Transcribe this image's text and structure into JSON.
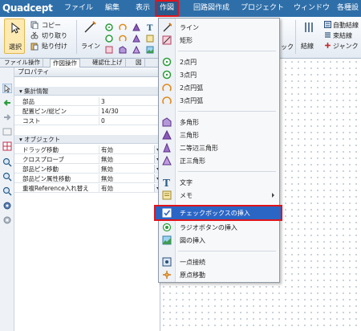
{
  "app": {
    "logo": "Quadcept"
  },
  "menubar": {
    "items": [
      "ファイル",
      "編集",
      "表示",
      "作図",
      "回路図作成",
      "プロジェクト",
      "ウィンドウ",
      "各種設"
    ]
  },
  "ribbon": {
    "select_label": "選択",
    "copy_label": "コピー",
    "cut_label": "切り取り",
    "paste_label": "貼り付け",
    "line_label": "ライン",
    "right_partial": "ック",
    "wire_label": "結線",
    "auto_wire_label": "自動結線",
    "bundle_wire_label": "束結線",
    "junction_label": "ジャンク"
  },
  "tabs": [
    "ファイル操作",
    "作図操作",
    "確認仕上げ",
    "図"
  ],
  "property_panel": {
    "title": "プロパティ",
    "groups": [
      {
        "name": "集計情報",
        "rows": [
          {
            "name": "部品",
            "value": "3"
          },
          {
            "name": "配置ピン/総ピン",
            "value": "14/30"
          },
          {
            "name": "コスト",
            "value": "0"
          }
        ]
      },
      {
        "name": "オブジェクト",
        "rows": [
          {
            "name": "ドラッグ移動",
            "value": "有効"
          },
          {
            "name": "クロスプローブ",
            "value": "無効"
          },
          {
            "name": "部品ピン移動",
            "value": "無効"
          },
          {
            "name": "部品ピン属性移動",
            "value": "無効"
          },
          {
            "name": "重複Reference入れ替え",
            "value": "有効"
          }
        ]
      }
    ]
  },
  "dropdown": {
    "items": [
      {
        "label": "ライン",
        "icon": "line-draw-icon"
      },
      {
        "label": "矩形",
        "icon": "rectangle-icon"
      },
      {
        "label": "2点円",
        "icon": "circle-2pt-icon"
      },
      {
        "label": "3点円",
        "icon": "circle-3pt-icon"
      },
      {
        "label": "2点円弧",
        "icon": "arc-2pt-icon"
      },
      {
        "label": "3点円弧",
        "icon": "arc-3pt-icon"
      },
      {
        "label": "多角形",
        "icon": "polygon-icon"
      },
      {
        "label": "三角形",
        "icon": "triangle-icon"
      },
      {
        "label": "二等辺三角形",
        "icon": "isosceles-triangle-icon"
      },
      {
        "label": "正三角形",
        "icon": "equilateral-triangle-icon"
      },
      {
        "label": "文字",
        "icon": "text-icon"
      },
      {
        "label": "メモ",
        "icon": "memo-icon"
      },
      {
        "label": "チェックボックスの挿入",
        "icon": "checkbox-icon"
      },
      {
        "label": "ラジオボタンの挿入",
        "icon": "radio-button-icon"
      },
      {
        "label": "図の挿入",
        "icon": "image-insert-icon"
      },
      {
        "label": "一点接続",
        "icon": "single-point-connect-icon"
      },
      {
        "label": "原点移動",
        "icon": "origin-move-icon"
      }
    ]
  },
  "colors": {
    "menubar": "#2f6fa9",
    "highlight": "#2b66c5",
    "callout_border": "#e0141b"
  }
}
